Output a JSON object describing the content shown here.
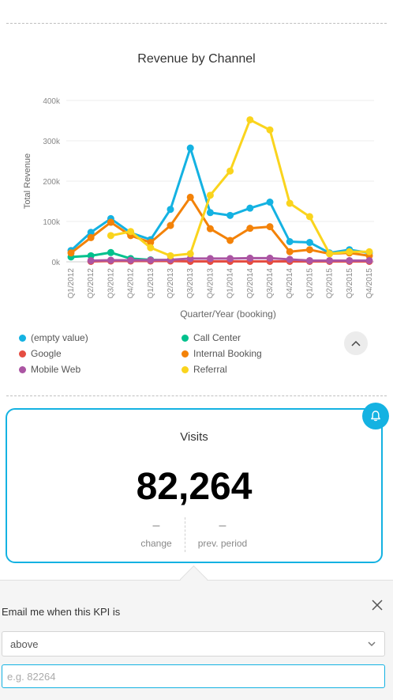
{
  "chart_data": {
    "type": "line",
    "title": "Revenue by Channel",
    "xlabel": "Quarter/Year (booking)",
    "ylabel": "Total Revenue",
    "ylim": [
      0,
      400000
    ],
    "yticks": [
      {
        "value": 0,
        "label": "0k"
      },
      {
        "value": 100000,
        "label": "100k"
      },
      {
        "value": 200000,
        "label": "200k"
      },
      {
        "value": 300000,
        "label": "300k"
      },
      {
        "value": 400000,
        "label": "400k"
      }
    ],
    "categories": [
      "Q1/2012",
      "Q2/2012",
      "Q3/2012",
      "Q4/2012",
      "Q1/2013",
      "Q2/2013",
      "Q3/2013",
      "Q4/2013",
      "Q1/2014",
      "Q2/2014",
      "Q3/2014",
      "Q4/2014",
      "Q1/2015",
      "Q2/2015",
      "Q3/2015",
      "Q4/2015"
    ],
    "grid": true,
    "legend_position": "bottom",
    "series": [
      {
        "name": "(empty value)",
        "color": "#14b2e2",
        "values": [
          28000,
          73000,
          107000,
          72000,
          55000,
          130000,
          282000,
          122000,
          115000,
          133000,
          148000,
          50000,
          48000,
          22000,
          30000,
          22000
        ]
      },
      {
        "name": "Call Center",
        "color": "#00c18d",
        "values": [
          12000,
          15000,
          23000,
          8000,
          5000,
          4000,
          null,
          null,
          null,
          null,
          null,
          null,
          null,
          null,
          null,
          null
        ]
      },
      {
        "name": "Google",
        "color": "#e54d42",
        "values": [
          null,
          1000,
          2000,
          2000,
          2000,
          2000,
          1000,
          1000,
          1000,
          1000,
          1000,
          1000,
          1000,
          1000,
          1000,
          1000
        ]
      },
      {
        "name": "Internal Booking",
        "color": "#f38208",
        "values": [
          22000,
          60000,
          98000,
          65000,
          48000,
          90000,
          160000,
          82000,
          53000,
          83000,
          87000,
          25000,
          30000,
          20000,
          22000,
          15000
        ]
      },
      {
        "name": "Mobile Web",
        "color": "#ab55a3",
        "values": [
          null,
          3000,
          4000,
          4000,
          4000,
          5000,
          8000,
          8000,
          8000,
          9000,
          9000,
          6000,
          3000,
          3000,
          3000,
          3000
        ]
      },
      {
        "name": "Referral",
        "color": "#fad41d",
        "values": [
          null,
          null,
          65000,
          75000,
          35000,
          15000,
          20000,
          165000,
          225000,
          352000,
          327000,
          145000,
          112000,
          20000,
          25000,
          25000
        ]
      }
    ]
  },
  "legend": [
    {
      "label": "(empty value)",
      "color": "#14b2e2"
    },
    {
      "label": "Call Center",
      "color": "#00c18d"
    },
    {
      "label": "Google",
      "color": "#e54d42"
    },
    {
      "label": "Internal Booking",
      "color": "#f38208"
    },
    {
      "label": "Mobile Web",
      "color": "#ab55a3"
    },
    {
      "label": "Referral",
      "color": "#fad41d"
    }
  ],
  "kpi": {
    "title": "Visits",
    "value": "82,264",
    "change_value": "–",
    "change_label": "change",
    "prev_value": "–",
    "prev_label": "prev. period"
  },
  "alert": {
    "label": "Email me when this KPI is",
    "condition": "above",
    "placeholder": "e.g. 82264"
  },
  "icons": {
    "collapse": "chevron-up-icon",
    "alert": "bell-icon",
    "close": "close-icon",
    "dropdown": "chevron-down-icon"
  },
  "colors": {
    "accent": "#14b2e2"
  }
}
